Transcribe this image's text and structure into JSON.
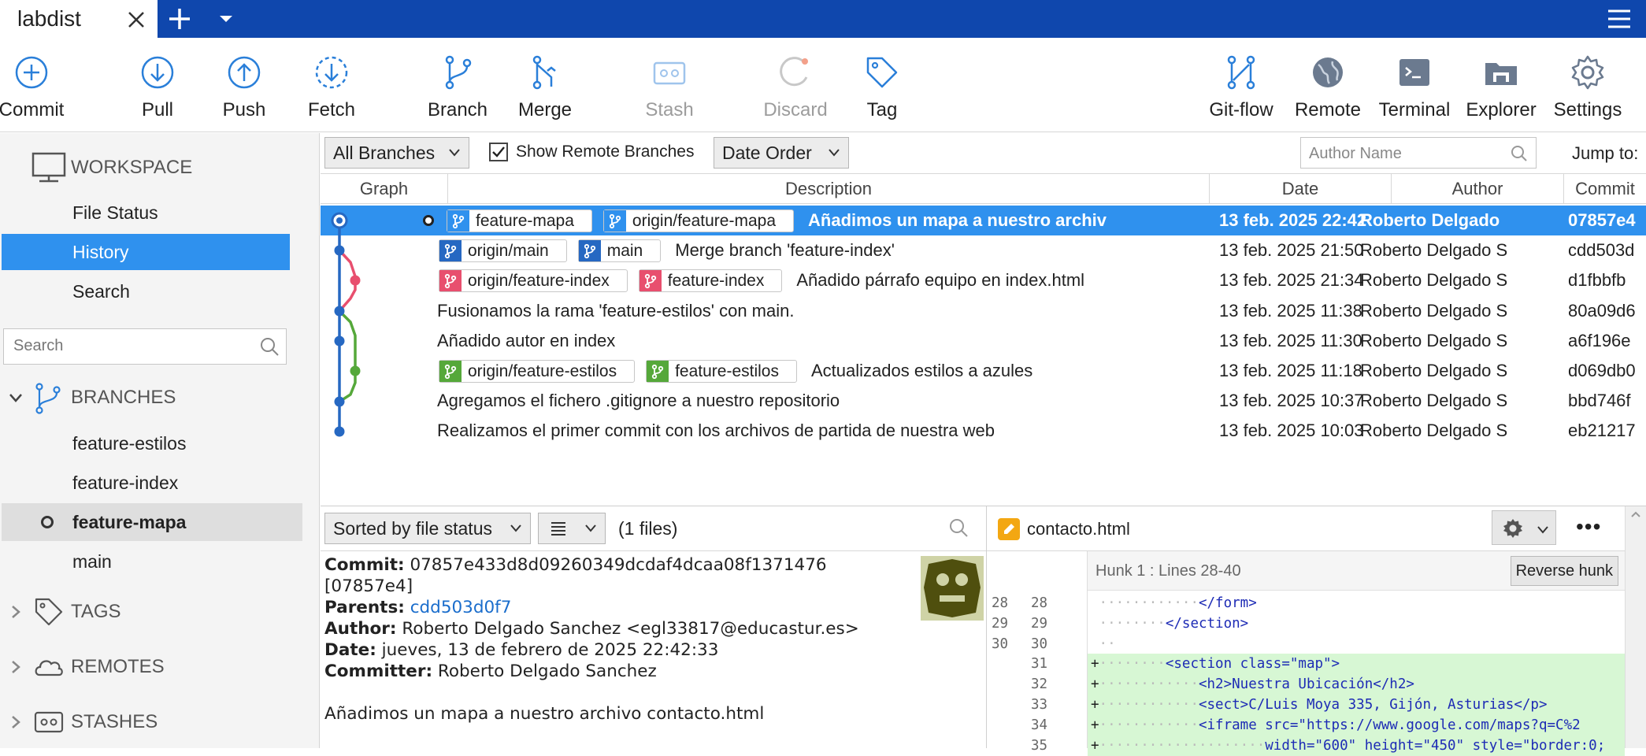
{
  "window": {
    "tab_title": "labdist"
  },
  "toolbar": {
    "items": [
      {
        "label": "Commit",
        "icon": "commit-icon"
      },
      {
        "label": "Pull",
        "icon": "pull-icon"
      },
      {
        "label": "Push",
        "icon": "push-icon"
      },
      {
        "label": "Fetch",
        "icon": "fetch-icon"
      },
      {
        "label": "Branch",
        "icon": "branch-icon"
      },
      {
        "label": "Merge",
        "icon": "merge-icon"
      },
      {
        "label": "Stash",
        "icon": "stash-icon",
        "disabled": true
      },
      {
        "label": "Discard",
        "icon": "discard-icon",
        "disabled": true
      },
      {
        "label": "Tag",
        "icon": "tag-icon"
      },
      {
        "label": "Git-flow",
        "icon": "gitflow-icon"
      },
      {
        "label": "Remote",
        "icon": "globe-icon"
      },
      {
        "label": "Terminal",
        "icon": "terminal-icon"
      },
      {
        "label": "Explorer",
        "icon": "explorer-icon"
      },
      {
        "label": "Settings",
        "icon": "gear-icon"
      }
    ]
  },
  "sidebar": {
    "workspace_title": "WORKSPACE",
    "nav": [
      {
        "label": "File Status",
        "active": false
      },
      {
        "label": "History",
        "active": true
      },
      {
        "label": "Search",
        "active": false
      }
    ],
    "search_placeholder": "Search",
    "sections": {
      "branches": "BRANCHES",
      "tags": "TAGS",
      "remotes": "REMOTES",
      "stashes": "STASHES"
    },
    "branches": [
      {
        "label": "feature-estilos",
        "current": false
      },
      {
        "label": "feature-index",
        "current": false
      },
      {
        "label": "feature-mapa",
        "current": true
      },
      {
        "label": "main",
        "current": false
      }
    ]
  },
  "filter": {
    "branches_select": "All Branches",
    "show_remote_label": "Show Remote Branches",
    "show_remote_checked": true,
    "order_select": "Date Order",
    "author_placeholder": "Author Name",
    "jump_to_label": "Jump to:"
  },
  "columns": {
    "graph": "Graph",
    "description": "Description",
    "date": "Date",
    "author": "Author",
    "commit": "Commit"
  },
  "commits": [
    {
      "refs": [
        {
          "name": "feature-mapa",
          "color": "#2f91ee"
        },
        {
          "name": "origin/feature-mapa",
          "color": "#2f91ee"
        }
      ],
      "message": "Añadimos un mapa a nuestro archiv",
      "date": "13 feb. 2025 22:42",
      "author": "Roberto Delgado",
      "hash": "07857e4",
      "selected": true,
      "current": true
    },
    {
      "refs": [
        {
          "name": "origin/main",
          "color": "#2668c2"
        },
        {
          "name": "main",
          "color": "#2668c2"
        }
      ],
      "message": "Merge branch 'feature-index'",
      "date": "13 feb. 2025 21:50",
      "author": "Roberto Delgado S",
      "hash": "cdd503d",
      "selected": false
    },
    {
      "refs": [
        {
          "name": "origin/feature-index",
          "color": "#e84f6e"
        },
        {
          "name": "feature-index",
          "color": "#e84f6e"
        }
      ],
      "message": "Añadido párrafo equipo en index.html",
      "date": "13 feb. 2025 21:34",
      "author": "Roberto Delgado S",
      "hash": "d1fbbfb",
      "selected": false
    },
    {
      "refs": [],
      "message": "Fusionamos la rama 'feature-estilos' con main.",
      "date": "13 feb. 2025 11:38",
      "author": "Roberto Delgado S",
      "hash": "80a09d6",
      "selected": false
    },
    {
      "refs": [],
      "message": "Añadido autor en index",
      "date": "13 feb. 2025 11:30",
      "author": "Roberto Delgado S",
      "hash": "a6f196e",
      "selected": false
    },
    {
      "refs": [
        {
          "name": "origin/feature-estilos",
          "color": "#55a83a"
        },
        {
          "name": "feature-estilos",
          "color": "#55a83a"
        }
      ],
      "message": "Actualizados estilos a azules",
      "date": "13 feb. 2025 11:18",
      "author": "Roberto Delgado S",
      "hash": "d069db0",
      "selected": false
    },
    {
      "refs": [],
      "message": "Agregamos el fichero .gitignore a nuestro repositorio",
      "date": "13 feb. 2025 10:37",
      "author": "Roberto Delgado S",
      "hash": "bbd746f",
      "selected": false
    },
    {
      "refs": [],
      "message": "Realizamos el primer commit con los archivos de partida de nuestra web",
      "date": "13 feb. 2025 10:03",
      "author": "Roberto Delgado S",
      "hash": "eb21217",
      "selected": false
    }
  ],
  "files_panel": {
    "sort_select": "Sorted by file status",
    "view_select_icon": "list-icon",
    "count_label": "(1 files)"
  },
  "details": {
    "commit_label": "Commit:",
    "commit_hash": "07857e433d8d09260349dcdaf4dcaa08f1371476",
    "short_hash": "[07857e4]",
    "parents_label": "Parents:",
    "parents": "cdd503d0f7",
    "author_label": "Author:",
    "author": "Roberto Delgado Sanchez <egl33817@educastur.es>",
    "date_label": "Date:",
    "date": "jueves, 13 de febrero de 2025 22:42:33",
    "committer_label": "Committer:",
    "committer": "Roberto Delgado Sanchez",
    "message": "Añadimos un mapa a nuestro archivo contacto.html"
  },
  "diff": {
    "file_name": "contacto.html",
    "hunk_label": "Hunk 1 : Lines 28-40",
    "reverse_button": "Reverse hunk",
    "lines": [
      {
        "old": "28",
        "new": "28",
        "added": false
      },
      {
        "old": "29",
        "new": "29",
        "added": false
      },
      {
        "old": "30",
        "new": "30",
        "added": false
      },
      {
        "old": "",
        "new": "31",
        "added": true
      },
      {
        "old": "",
        "new": "32",
        "added": true
      },
      {
        "old": "",
        "new": "33",
        "added": true
      },
      {
        "old": "",
        "new": "34",
        "added": true
      },
      {
        "old": "",
        "new": "35",
        "added": true
      }
    ],
    "code": [
      "</form>",
      "</section>",
      "",
      "<section class=\"map\">",
      "<h2>Nuestra Ubicación</h2>",
      "<sect>C/Luis Moya 335, Gijón, Asturias</p>",
      "<iframe src=\"https://www.google.com/maps?q=C%2",
      "width=\"600\" height=\"450\" style=\"border:0;"
    ]
  }
}
